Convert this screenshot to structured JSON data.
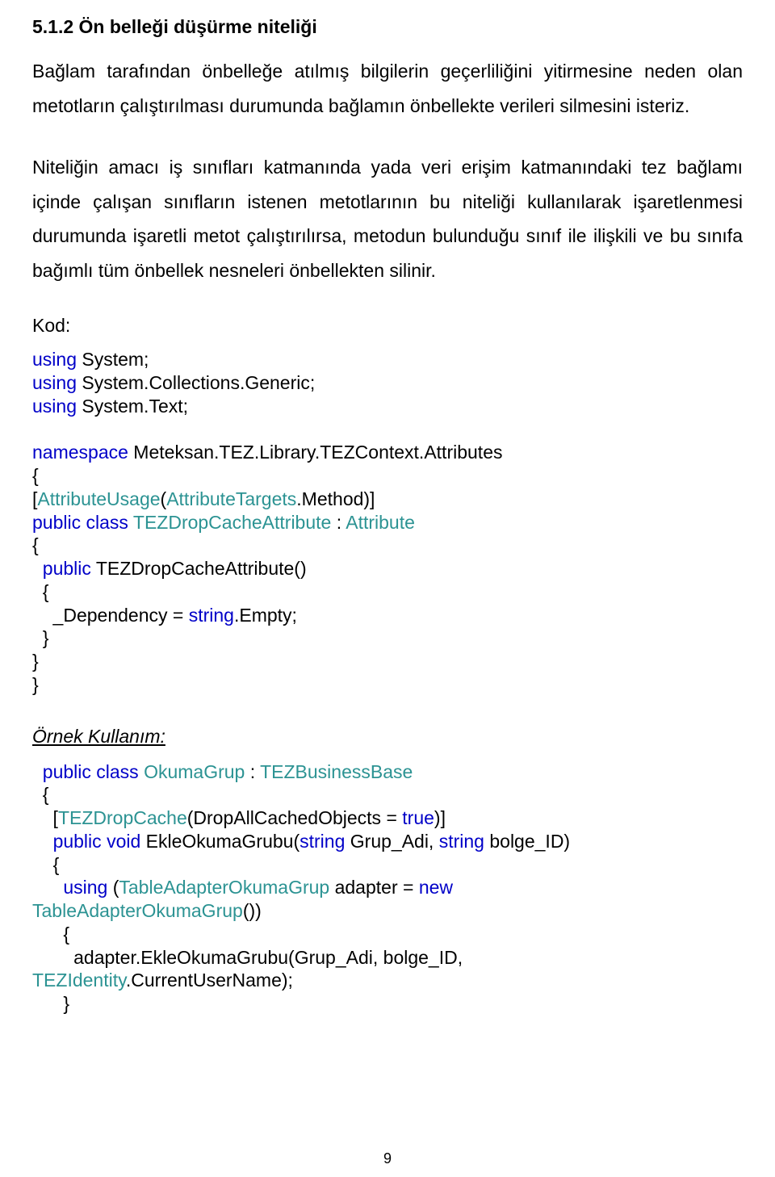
{
  "heading": "5.1.2 Ön belleği düşürme niteliği",
  "para1": "Bağlam tarafından önbelleğe atılmış bilgilerin geçerliliğini yitirmesine neden olan metotların çalıştırılması durumunda bağlamın önbellekte verileri silmesini isteriz.",
  "para2": "Niteliğin amacı iş sınıfları katmanında yada veri erişim katmanındaki tez bağlamı içinde çalışan sınıfların istenen metotlarının bu niteliği kullanılarak işaretlenmesi durumunda işaretli metot çalıştırılırsa, metodun bulunduğu sınıf ile ilişkili ve bu sınıfa bağımlı tüm önbellek nesneleri önbellekten silinir.",
  "kod_label": "Kod:",
  "code1": {
    "using": "using",
    "system": " System;",
    "system_collections": " System.Collections.Generic;",
    "system_text": " System.Text;",
    "namespace_kw": "namespace",
    "namespace_val": " Meteksan.TEZ.Library.TEZContext.Attributes",
    "open_brace": "{",
    "attr_usage_type": "AttributeUsage",
    "attr_targets_type": "AttributeTargets",
    "method_txt": ".Method)]",
    "public_kw": "public",
    "class_kw": "class",
    "tez_drop_attr": "TEZDropCacheAttribute",
    "colon_sp": " : ",
    "attribute_type": "Attribute",
    "ctor_name": " TEZDropCacheAttribute()",
    "dep_line_a": "    _Dependency = ",
    "string_kw": "string",
    "empty_txt": ".Empty;",
    "close_brace": "}"
  },
  "ornek_label": "Örnek Kullanım:",
  "code2": {
    "public_kw": "public",
    "class_kw": "class",
    "okuma_grup": "OkumaGrup",
    "colon_sp": " : ",
    "tez_bb": "TEZBusinessBase",
    "open_brace": "{",
    "tez_dropcache": "TEZDropCache",
    "drop_all_txt": "(DropAllCachedObjects = ",
    "true_kw": "true",
    "close_attr": ")]",
    "void_kw": "void",
    "ekle_name": " EkleOkumaGrubu(",
    "string_kw": "string",
    "grup_adi": " Grup_Adi, ",
    "bolge_id_param": " bolge_ID)",
    "using_kw": "using",
    "table_adapter": "TableAdapterOkumaGrup",
    "adapter_eq": " adapter = ",
    "new_kw": "new",
    "ta_ctor": "TableAdapterOkumaGrup",
    "ctor_parens": "())",
    "adapter_call": "        adapter.EkleOkumaGrubu(Grup_Adi, bolge_ID,",
    "tez_identity": "TEZIdentity",
    "current_un": ".CurrentUserName);",
    "close_brace": "}"
  },
  "page_number": "9"
}
